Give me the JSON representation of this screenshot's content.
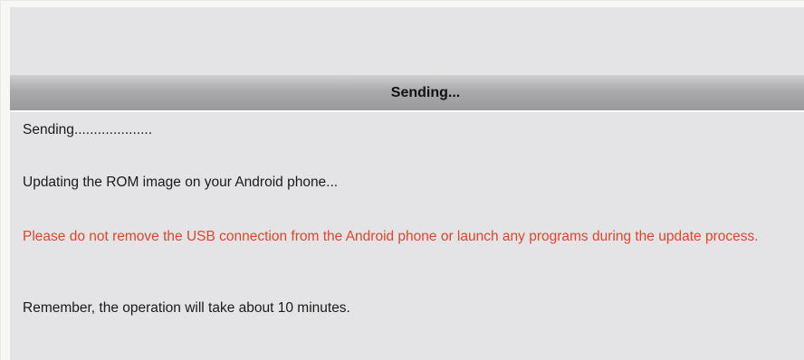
{
  "dialog": {
    "title": "Sending...",
    "status_line": "Sending....................",
    "updating_text": "Updating the ROM image on your Android phone...",
    "warning_text": "Please do not remove the USB connection from the Android phone or launch any programs during the update process.",
    "duration_text": "Remember, the operation will take about 10 minutes."
  },
  "colors": {
    "panel_background": "#e4e4e6",
    "title_bar": "#a9a9ab",
    "warning_text": "#e0452b",
    "body_text": "#1a1a1a"
  }
}
